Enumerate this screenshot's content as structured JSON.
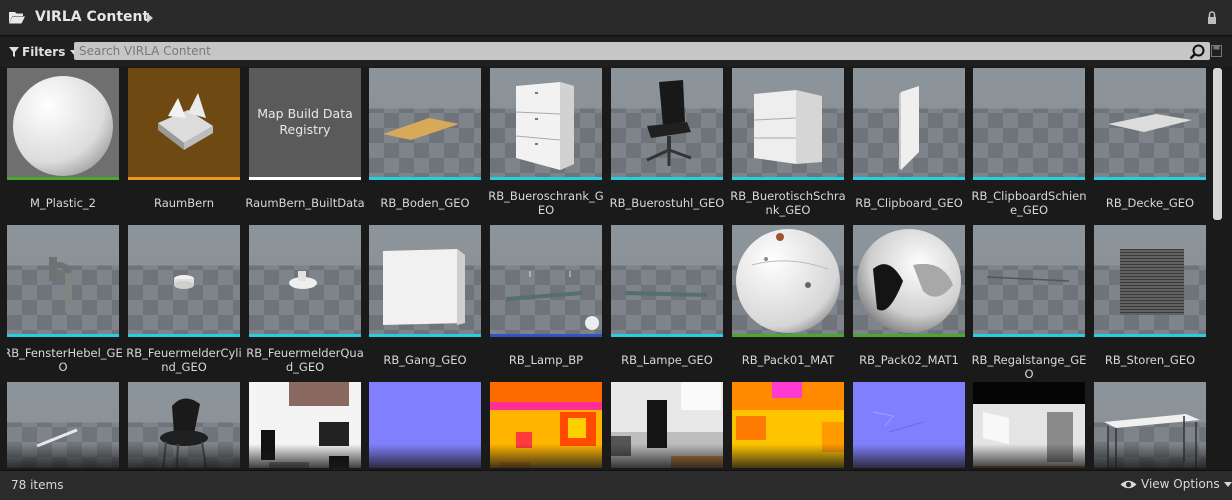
{
  "header": {
    "title": "VIRLA Content"
  },
  "search": {
    "filters_label": "Filters",
    "placeholder": "Search VIRLA Content"
  },
  "colors": {
    "material": "#4aa82e",
    "blueprint": "#3452c8",
    "static_mesh": "#25cfe0",
    "build_data": "#ffffff",
    "level": "#e89c24"
  },
  "assets": [
    {
      "name": "M_Plastic_2",
      "type_color": "#4aa82e",
      "thumb": "sphere-white"
    },
    {
      "name": "RaumBern",
      "type_color": "#e89c24",
      "thumb": "level"
    },
    {
      "name": "RaumBern_BuiltData",
      "type_color": "#ffffff",
      "thumb": "text",
      "thumb_text": "Map Build Data Registry"
    },
    {
      "name": "RB_Boden_GEO",
      "type_color": "#25cfe0",
      "thumb": "floor-mat"
    },
    {
      "name": "RB_Bueroschrank_GEO",
      "type_color": "#25cfe0",
      "thumb": "cabinet"
    },
    {
      "name": "RB_Buerostuhl_GEO",
      "type_color": "#25cfe0",
      "thumb": "chair"
    },
    {
      "name": "RB_BuerotischSchrank_GEO",
      "type_color": "#25cfe0",
      "thumb": "drawer"
    },
    {
      "name": "RB_Clipboard_GEO",
      "type_color": "#25cfe0",
      "thumb": "board"
    },
    {
      "name": "RB_ClipboardSchiene_GEO",
      "type_color": "#25cfe0",
      "thumb": "empty"
    },
    {
      "name": "RB_Decke_GEO",
      "type_color": "#25cfe0",
      "thumb": "plate"
    },
    {
      "name": "RB_FensterHebel_GEO",
      "type_color": "#25cfe0",
      "thumb": "handle"
    },
    {
      "name": "RB_FeuermelderCylind_GEO",
      "type_color": "#25cfe0",
      "thumb": "puck"
    },
    {
      "name": "RB_FeuermelderQuad_GEO",
      "type_color": "#25cfe0",
      "thumb": "puck2"
    },
    {
      "name": "RB_Gang_GEO",
      "type_color": "#25cfe0",
      "thumb": "box"
    },
    {
      "name": "RB_Lamp_BP",
      "type_color": "#3452c8",
      "thumb": "lamp"
    },
    {
      "name": "RB_Lampe_GEO",
      "type_color": "#25cfe0",
      "thumb": "lamp2"
    },
    {
      "name": "RB_Pack01_MAT",
      "type_color": "#4aa82e",
      "thumb": "sphere-pack1"
    },
    {
      "name": "RB_Pack02_MAT1",
      "type_color": "#4aa82e",
      "thumb": "sphere-pack2"
    },
    {
      "name": "RB_Regalstange_GEO",
      "type_color": "#25cfe0",
      "thumb": "rod"
    },
    {
      "name": "RB_Storen_GEO",
      "type_color": "#25cfe0",
      "thumb": "blinds"
    },
    {
      "name": "",
      "type_color": "",
      "thumb": "stick"
    },
    {
      "name": "",
      "type_color": "",
      "thumb": "chair2"
    },
    {
      "name": "",
      "type_color": "",
      "thumb": "tex-white"
    },
    {
      "name": "",
      "type_color": "",
      "thumb": "tex-normal"
    },
    {
      "name": "",
      "type_color": "",
      "thumb": "tex-orange"
    },
    {
      "name": "",
      "type_color": "",
      "thumb": "tex-mix"
    },
    {
      "name": "",
      "type_color": "",
      "thumb": "tex-orange2"
    },
    {
      "name": "",
      "type_color": "",
      "thumb": "tex-normal2"
    },
    {
      "name": "",
      "type_color": "",
      "thumb": "photo"
    },
    {
      "name": "",
      "type_color": "",
      "thumb": "table"
    }
  ],
  "footer": {
    "item_count": "78 items",
    "view_options": "View Options"
  }
}
